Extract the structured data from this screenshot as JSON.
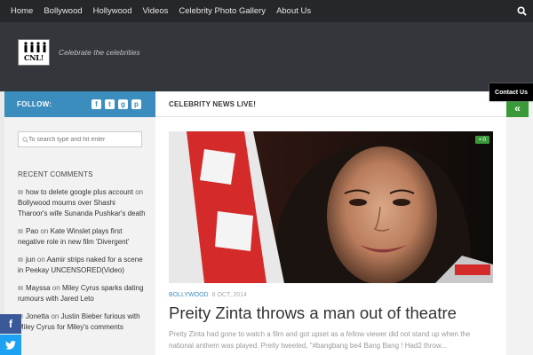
{
  "nav": {
    "items": [
      "Home",
      "Bollywood",
      "Hollywood",
      "Videos",
      "Celebrity Photo Gallery",
      "About Us"
    ]
  },
  "header": {
    "logo_text": "CNL!",
    "tagline": "Celebrate the celebrities"
  },
  "contact_tab": "Contact Us",
  "sidebar": {
    "follow_label": "FOLLOW:",
    "search_placeholder": "To search type and hit enter",
    "recent_comments_title": "RECENT COMMENTS",
    "comments": [
      {
        "author": "how to delete google plus account",
        "on": "on",
        "post": "Bollywood mourns over Shashi Tharoor's wife Sunanda Pushkar's death"
      },
      {
        "author": "Pao",
        "on": "on",
        "post": "Kate Winslet plays first negative role in new film 'Divergent'"
      },
      {
        "author": "jun",
        "on": "on",
        "post": "Aamir strips naked for a scene in Peekay UNCENSORED(Video)"
      },
      {
        "author": "Mayssa",
        "on": "on",
        "post": "Miley Cyrus sparks dating rumours with Jared Leto"
      },
      {
        "author": "Jonetta",
        "on": "on",
        "post": "Justin Bieber furious with Miley Cyrus for Miley's comments"
      }
    ]
  },
  "main": {
    "section_title": "CELEBRITY NEWS LIVE!",
    "comment_count": "0",
    "category": "BOLLYWOOD",
    "date": "8 OCT, 2014",
    "post_title": "Preity Zinta throws a man out of theatre",
    "excerpt": "Preity Zinta had gone to watch a film and got upset as a fellow viewer did not stand up when the national anthem was played. Preity tweeted, \"#bangbang be4 Bang Bang ! Had2 throw..."
  },
  "colors": {
    "nav_bg": "#26272b",
    "header_bg": "#33363b",
    "accent_blue": "#3b8dbd",
    "accent_green": "#3a9a3a"
  }
}
